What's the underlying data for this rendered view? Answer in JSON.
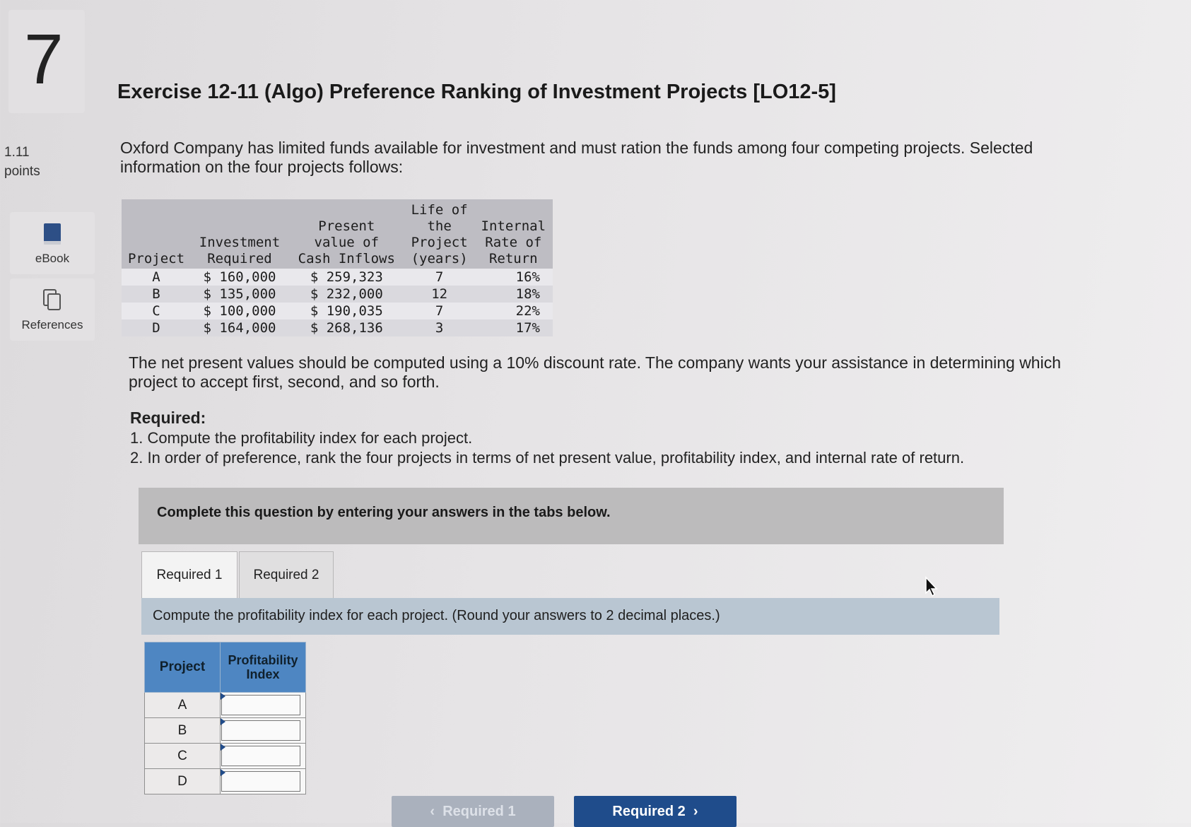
{
  "question": {
    "number": "7",
    "points_value": "1.11",
    "points_label": "points"
  },
  "tools": [
    {
      "label": "eBook",
      "icon": "book-icon"
    },
    {
      "label": "References",
      "icon": "copy-icon"
    }
  ],
  "title": "Exercise 12-11 (Algo) Preference Ranking of Investment Projects [LO12-5]",
  "intro": "Oxford Company has limited funds available for investment and must ration the funds among four competing projects. Selected information on the four projects follows:",
  "project_table": {
    "headers": [
      "Project",
      "Investment\nRequired",
      "Present\nvalue of\nCash Inflows",
      "Life of\nthe\nProject\n(years)",
      "Internal\nRate of\nReturn"
    ],
    "rows": [
      [
        "A",
        "$ 160,000",
        "$ 259,323",
        "7",
        "16%"
      ],
      [
        "B",
        "$ 135,000",
        "$ 232,000",
        "12",
        "18%"
      ],
      [
        "C",
        "$ 100,000",
        "$ 190,035",
        "7",
        "22%"
      ],
      [
        "D",
        "$ 164,000",
        "$ 268,136",
        "3",
        "17%"
      ]
    ]
  },
  "discount_text": "The net present values should be computed using a 10% discount rate. The company wants your assistance in determining which project to accept first, second, and so forth.",
  "required": {
    "heading": "Required:",
    "items": [
      "1. Compute the profitability index for each project.",
      "2. In order of preference, rank the four projects in terms of net present value, profitability index, and internal rate of return."
    ]
  },
  "banner": "Complete this question by entering your answers in the tabs below.",
  "tabs": [
    {
      "label": "Required 1",
      "active": true
    },
    {
      "label": "Required 2",
      "active": false
    }
  ],
  "instruction": "Compute the profitability index for each project. (Round your answers to 2 decimal places.)",
  "pi_table": {
    "headers": [
      "Project",
      "Profitability Index"
    ],
    "rows": [
      {
        "project": "A",
        "value": ""
      },
      {
        "project": "B",
        "value": ""
      },
      {
        "project": "C",
        "value": ""
      },
      {
        "project": "D",
        "value": ""
      }
    ]
  },
  "nav": {
    "prev": "Required 1",
    "next": "Required 2"
  },
  "colors": {
    "header_blue": "#4e86c2",
    "nav_blue": "#1f4c8b",
    "instruction_bg": "#b9c6d2"
  }
}
